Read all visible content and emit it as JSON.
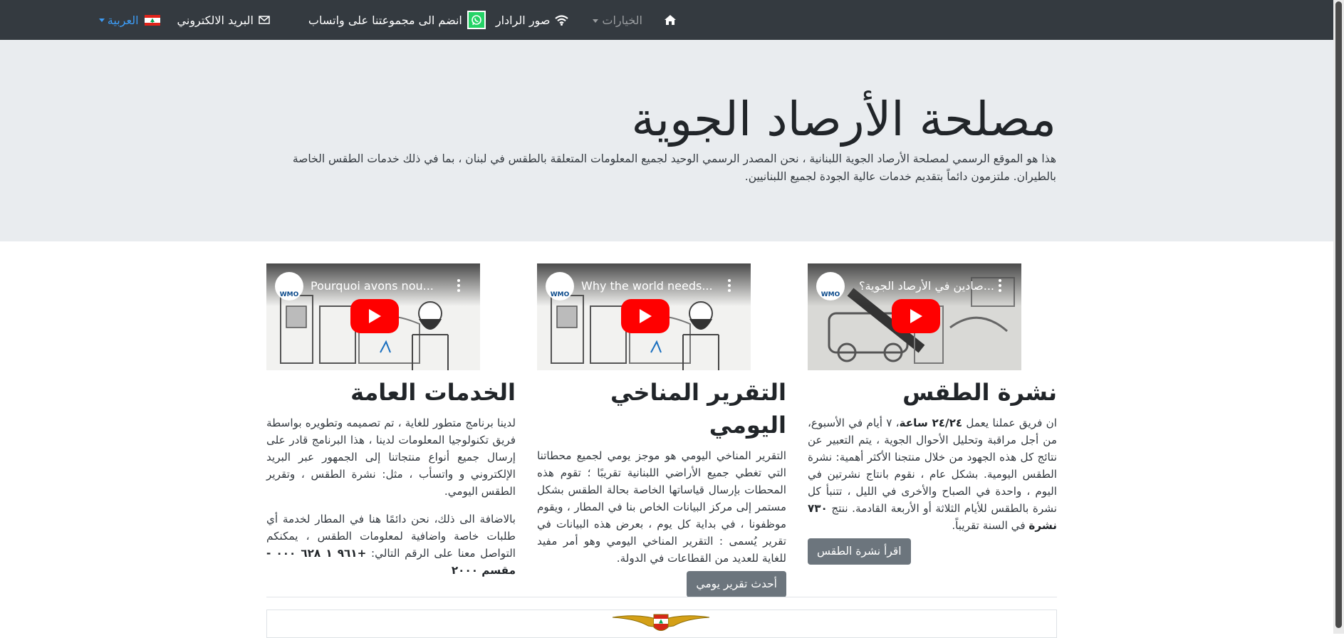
{
  "nav": {
    "home_icon": "home-icon",
    "options_label": "الخيارات",
    "radar_label": "صور الرادار",
    "radar_icon": "wifi-icon",
    "whatsapp_label": "انضم الى مجموعتنا على واتساب",
    "whatsapp_icon": "whatsapp-icon",
    "email_label": "البريد الالكتروني",
    "email_icon": "envelope-icon",
    "language_label": "العربية",
    "language_icon": "lebanon-flag-icon"
  },
  "hero": {
    "title": "مصلحة الأرصاد الجوية",
    "lead": "هذا هو الموقع الرسمي لمصلحة الأرصاد الجوية اللبنانية ، نحن المصدر الرسمي الوحيد لجميع المعلومات المتعلقة بالطقس في لبنان ، بما في ذلك خدمات الطقس الخاصة بالطيران. ملتزمون دائماً بتقديم خدمات عالية الجودة لجميع اللبنانيين."
  },
  "cards": [
    {
      "video_title": "...صادين في الأرصاد الجوية؟",
      "video_badge": "WMO",
      "title": "نشرة الطقس",
      "text_parts": [
        "ان فريق عملنا يعمل ",
        "٢٤/٢٤ ساعة",
        "، ٧ أيام في الأسبوع، من أجل مراقبة وتحليل الأحوال الجوية ، يتم التعبير عن نتائج كل هذه الجهود من خلال منتجنا الأكثر أهمية: نشرة الطقس اليومية. بشكل عام ، نقوم بانتاج نشرتين في اليوم ، واحدة في الصباح والأخرى في الليل ، تتنبأ كل نشرة بالطقس للأيام الثلاثة أو الأربعة القادمة. ننتج ",
        "٧٣٠ نشرة",
        " في السنة تقريباً."
      ],
      "button": "اقرأ نشرة الطقس"
    },
    {
      "video_title": "Why the world needs...",
      "video_badge": "WMO",
      "title": "التقرير المناخي اليومي",
      "text": "التقرير المناخي اليومي هو موجز يومي لجميع محطاتنا التي تغطي جميع الأراضي اللبنانية تقريبًا ؛ تقوم هذه المحطات بإرسال قياساتها الخاصة بحالة الطقس بشكل مستمر إلى مركز البيانات الخاص بنا في المطار ، ويقوم موظفونا ، في بداية كل يوم ، بعرض هذه البيانات في تقرير يُسمى : التقرير المناخي اليومي وهو أمر مفيد للغاية للعديد من القطاعات في الدولة.",
      "button": "أحدث تقرير يومي"
    },
    {
      "video_title": "Pourquoi avons nou...",
      "video_badge": "WMO",
      "title": "الخدمات العامة",
      "text": "لدينا برنامج متطور للغاية ، تم تصميمه وتطويره بواسطة فريق تكنولوجيا المعلومات لدينا ، هذا البرنامج قادر على إرسال جميع أنواع منتجاتنا إلى الجمهور عبر البريد الإلكتروني و واتسأب ، مثل: نشرة الطقس ، وتقرير الطقس اليومي.",
      "text2_parts": [
        "بالاضافة الى ذلك، نحن دائمًا هنا في المطار لخدمة أي طلبات خاصة واضافية لمعلومات الطقس ، يمكنكم التواصل معنا على الرقم التالي: ",
        "+٩٦١ ١ ٦٢٨ ٠٠٠ - مقسم ٢٠٠٠"
      ]
    }
  ],
  "footer": {
    "emblem_icon": "air-force-wings-emblem-icon"
  },
  "colors": {
    "navbar": "#343a40",
    "hero_bg": "#e9ecef",
    "button": "#6c757d",
    "link_accent": "#3d9cf5",
    "youtube_red": "#ff0000",
    "whatsapp_green": "#25d366"
  }
}
